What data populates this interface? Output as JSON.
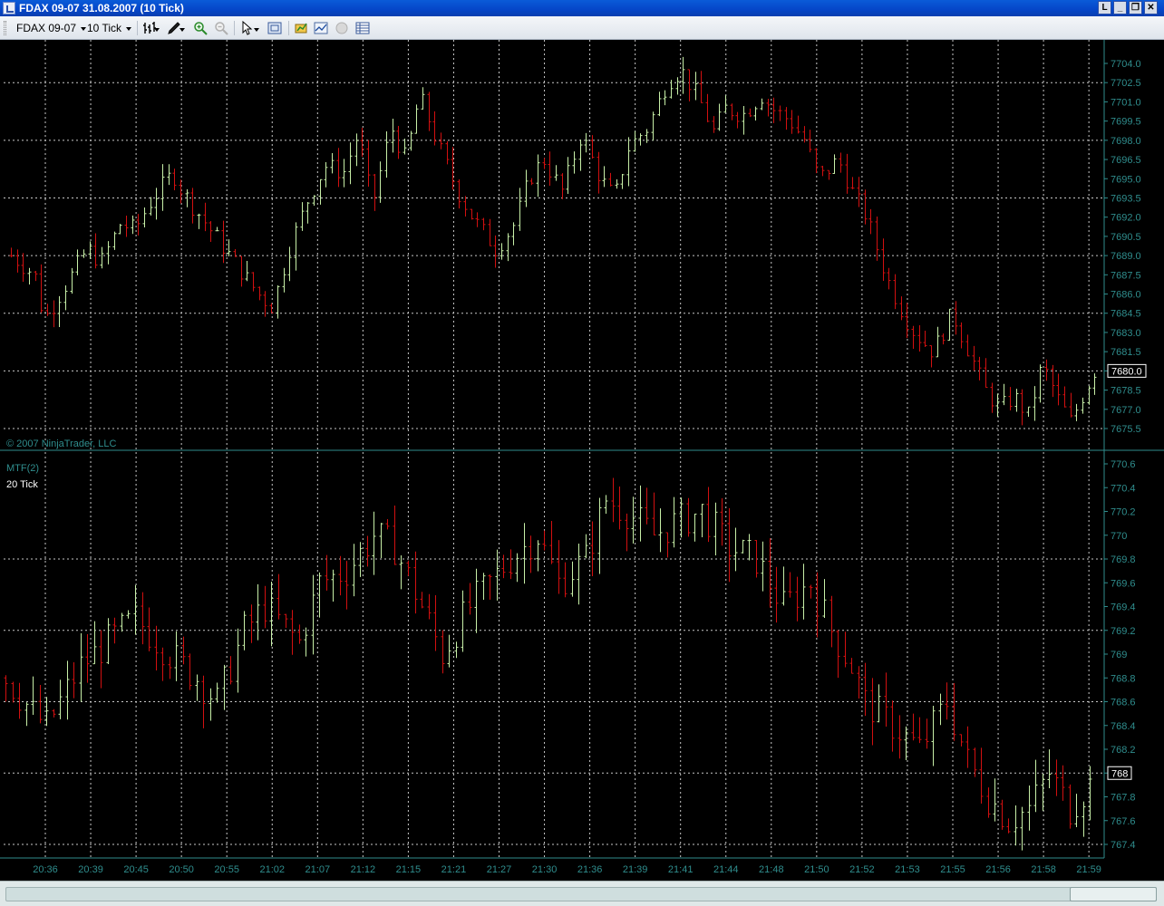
{
  "window": {
    "title": "FDAX 09-07  31.08.2007  (10 Tick)",
    "btn_l": "L",
    "btn_min": "_",
    "btn_restore": "❐",
    "btn_close": "✕"
  },
  "toolbar": {
    "instrument": "FDAX 09-07",
    "interval": "10 Tick",
    "icons": [
      "bar-style-icon",
      "draw-tool-icon",
      "zoom-in-icon",
      "zoom-out-icon",
      "pointer-icon",
      "snapshot-icon",
      "instrument-icon",
      "indicators-icon",
      "strategy-icon",
      "data-box-icon"
    ]
  },
  "colors": {
    "up_bar": "#c8f0a8",
    "down_bar": "#d21010",
    "grid": "#c8c8c8",
    "axis_text": "#2f8d8d",
    "divider": "#2f8d8d",
    "background": "#000000"
  },
  "chart": {
    "copyright": "© 2007 NinjaTrader, LLC",
    "indicator_label": "MTF(2)",
    "indicator_period": "20 Tick",
    "upper_y_ticks": [
      "7704.0",
      "7702.5",
      "7701.0",
      "7699.5",
      "7698.0",
      "7696.5",
      "7695.0",
      "7693.5",
      "7692.0",
      "7690.5",
      "7689.0",
      "7687.5",
      "7686.0",
      "7684.5",
      "7683.0",
      "7681.5",
      "7680.0",
      "7678.5",
      "7677.0",
      "7675.5"
    ],
    "upper_last_price": "7680.0",
    "lower_y_ticks": [
      "770.6",
      "770.4",
      "770.2",
      "770",
      "769.8",
      "769.6",
      "769.4",
      "769.2",
      "769",
      "768.8",
      "768.6",
      "768.4",
      "768.2",
      "768",
      "767.8",
      "767.6",
      "767.4"
    ],
    "lower_last_price": "768",
    "x_ticks": [
      "20:36",
      "20:39",
      "20:45",
      "20:50",
      "20:55",
      "21:02",
      "21:07",
      "21:12",
      "21:15",
      "21:21",
      "21:27",
      "21:30",
      "21:36",
      "21:39",
      "21:41",
      "21:44",
      "21:48",
      "21:50",
      "21:52",
      "21:53",
      "21:55",
      "21:56",
      "21:58",
      "21:59"
    ]
  },
  "chart_data": [
    {
      "type": "ohlc",
      "name": "FDAX 09-07 (10 Tick)",
      "ylim": [
        7675.0,
        7704.5
      ],
      "bars": 180,
      "path": [
        [
          0,
          7689.0
        ],
        [
          5,
          7687.5
        ],
        [
          7,
          7684.0
        ],
        [
          12,
          7687.0
        ],
        [
          16,
          7689.5
        ],
        [
          19,
          7688.5
        ],
        [
          23,
          7691.5
        ],
        [
          26,
          7691.0
        ],
        [
          29,
          7693.0
        ],
        [
          34,
          7695.5
        ],
        [
          36,
          7694.0
        ],
        [
          42,
          7691.0
        ],
        [
          46,
          7689.0
        ],
        [
          52,
          7686.0
        ],
        [
          55,
          7685.0
        ],
        [
          58,
          7689.0
        ],
        [
          62,
          7693.0
        ],
        [
          66,
          7696.0
        ],
        [
          70,
          7695.5
        ],
        [
          73,
          7698.5
        ],
        [
          76,
          7693.0
        ],
        [
          80,
          7699.0
        ],
        [
          83,
          7696.5
        ],
        [
          86,
          7701.5
        ],
        [
          90,
          7697.5
        ],
        [
          94,
          7694.0
        ],
        [
          97,
          7692.0
        ],
        [
          102,
          7689.5
        ],
        [
          106,
          7691.5
        ],
        [
          109,
          7695.0
        ],
        [
          112,
          7696.5
        ],
        [
          116,
          7694.0
        ],
        [
          120,
          7698.5
        ],
        [
          124,
          7695.0
        ],
        [
          127,
          7693.5
        ],
        [
          130,
          7697.5
        ],
        [
          134,
          7699.0
        ],
        [
          138,
          7702.5
        ],
        [
          141,
          7703.5
        ],
        [
          145,
          7701.0
        ],
        [
          148,
          7698.5
        ],
        [
          150,
          7700.5
        ],
        [
          154,
          7700.0
        ],
        [
          158,
          7701.5
        ],
        [
          160,
          7700.5
        ],
        [
          164,
          7699.5
        ],
        [
          167,
          7698.0
        ],
        [
          170,
          7695.0
        ],
        [
          174,
          7696.5
        ],
        [
          177,
          7694.0
        ],
        [
          180,
          7692.0
        ],
        [
          184,
          7687.5
        ],
        [
          187,
          7685.0
        ],
        [
          190,
          7683.0
        ],
        [
          194,
          7681.5
        ],
        [
          198,
          7684.5
        ],
        [
          201,
          7682.0
        ],
        [
          205,
          7678.5
        ],
        [
          208,
          7677.0
        ],
        [
          211,
          7678.0
        ],
        [
          214,
          7676.5
        ],
        [
          217,
          7680.5
        ],
        [
          220,
          7678.0
        ],
        [
          223,
          7676.0
        ],
        [
          226,
          7678.5
        ],
        [
          228,
          7680.0
        ]
      ]
    },
    {
      "type": "ohlc",
      "name": "MTF(2) 20 Tick",
      "ylim": [
        767.35,
        770.65
      ],
      "bars": 160,
      "path": [
        [
          0,
          768.8
        ],
        [
          4,
          768.5
        ],
        [
          6,
          768.4
        ],
        [
          11,
          768.9
        ],
        [
          15,
          769.1
        ],
        [
          19,
          769.3
        ],
        [
          24,
          769.0
        ],
        [
          28,
          768.8
        ],
        [
          31,
          768.6
        ],
        [
          35,
          769.2
        ],
        [
          38,
          769.4
        ],
        [
          43,
          769.1
        ],
        [
          46,
          769.6
        ],
        [
          50,
          769.7
        ],
        [
          54,
          770.0
        ],
        [
          57,
          769.9
        ],
        [
          61,
          769.4
        ],
        [
          64,
          769.0
        ],
        [
          68,
          769.4
        ],
        [
          71,
          769.6
        ],
        [
          74,
          769.8
        ],
        [
          78,
          770.0
        ],
        [
          81,
          769.6
        ],
        [
          85,
          769.8
        ],
        [
          88,
          770.3
        ],
        [
          91,
          770.2
        ],
        [
          95,
          770.0
        ],
        [
          98,
          770.1
        ],
        [
          102,
          770.2
        ],
        [
          106,
          769.9
        ],
        [
          110,
          769.8
        ],
        [
          114,
          769.4
        ],
        [
          118,
          769.6
        ],
        [
          121,
          769.2
        ],
        [
          124,
          768.9
        ],
        [
          126,
          768.6
        ],
        [
          130,
          768.4
        ],
        [
          134,
          768.2
        ],
        [
          138,
          768.6
        ],
        [
          141,
          768.1
        ],
        [
          144,
          767.8
        ],
        [
          147,
          767.6
        ],
        [
          150,
          767.7
        ],
        [
          153,
          768.0
        ],
        [
          156,
          767.7
        ],
        [
          159,
          767.9
        ]
      ]
    }
  ]
}
